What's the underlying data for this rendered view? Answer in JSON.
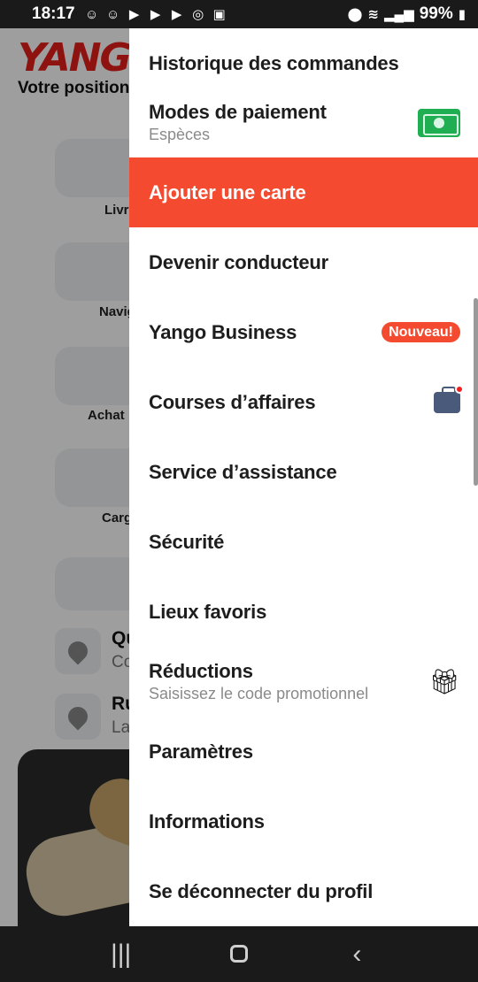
{
  "status_bar": {
    "time": "18:17",
    "battery": "99%",
    "notification_icons": [
      "snapchat-icon",
      "snapchat-icon",
      "youtube-icon",
      "youtube-icon",
      "youtube-icon",
      "instagram-icon",
      "gallery-icon"
    ],
    "system_icons": [
      "location-icon",
      "wifi-icon",
      "signal-icon",
      "battery-icon"
    ]
  },
  "background": {
    "logo": "YANGO",
    "position_label": "Votre position",
    "services": [
      "Livr",
      "Navig",
      "Achat",
      "Carg"
    ],
    "addresses": [
      {
        "title": "Qu",
        "sub": "Co"
      },
      {
        "title": "Ru",
        "sub": "La"
      }
    ]
  },
  "menu": {
    "items": [
      {
        "label": "Historique des commandes"
      },
      {
        "label": "Modes de paiement",
        "sub": "Espèces"
      },
      {
        "label": "Ajouter une carte"
      },
      {
        "label": "Devenir conducteur"
      },
      {
        "label": "Yango Business",
        "badge": "Nouveau!"
      },
      {
        "label": "Courses d’affaires"
      },
      {
        "label": "Service d’assistance"
      },
      {
        "label": "Sécurité"
      },
      {
        "label": "Lieux favoris"
      },
      {
        "label": "Réductions",
        "sub": "Saisissez le code promotionnel"
      },
      {
        "label": "Paramètres"
      },
      {
        "label": "Informations"
      },
      {
        "label": "Se déconnecter du profil"
      }
    ]
  },
  "colors": {
    "accent": "#f44a2f",
    "logo": "#e5201a"
  }
}
